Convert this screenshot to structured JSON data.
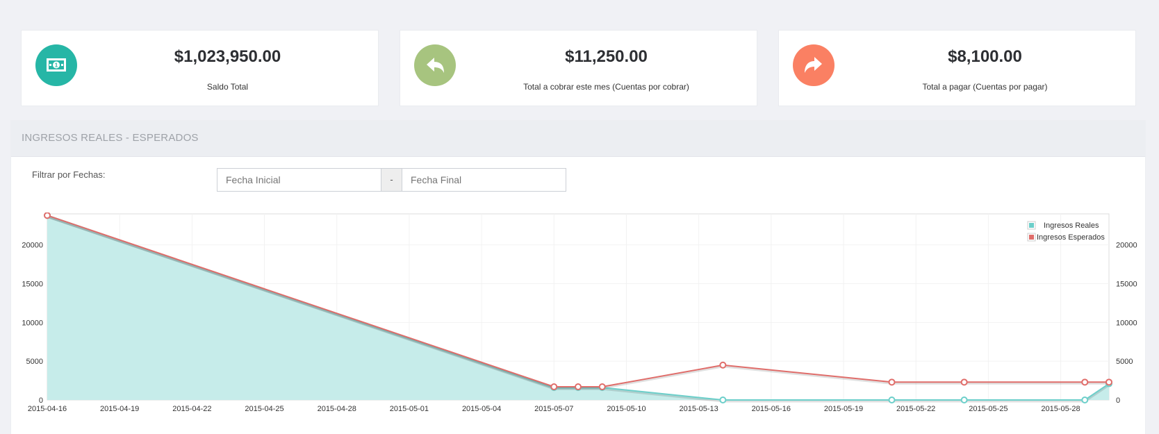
{
  "stats": [
    {
      "amount": "$1,023,950.00",
      "caption": "Saldo Total",
      "color": "#26b6a6",
      "icon": "money-bill-icon"
    },
    {
      "amount": "$11,250.00",
      "caption": "Total a cobrar este mes (Cuentas por cobrar)",
      "color": "#a7c47f",
      "icon": "reply-arrow-icon"
    },
    {
      "amount": "$8,100.00",
      "caption": "Total a pagar (Cuentas por pagar)",
      "color": "#fa8063",
      "icon": "share-arrow-icon"
    }
  ],
  "panel": {
    "title": "INGRESOS REALES - ESPERADOS",
    "filter_label": "Filtrar por Fechas:",
    "start_placeholder": "Fecha Inicial",
    "separator": "-",
    "end_placeholder": "Fecha Final"
  },
  "chart_data": {
    "type": "area",
    "x_ticks": [
      "2015-04-16",
      "2015-04-19",
      "2015-04-22",
      "2015-04-25",
      "2015-04-28",
      "2015-05-01",
      "2015-05-04",
      "2015-05-07",
      "2015-05-10",
      "2015-05-13",
      "2015-05-16",
      "2015-05-19",
      "2015-05-22",
      "2015-05-25",
      "2015-05-28"
    ],
    "y_ticks": [
      0,
      5000,
      10000,
      15000,
      20000
    ],
    "xlim": [
      "2015-04-16",
      "2015-05-30"
    ],
    "ylim": [
      0,
      24000
    ],
    "grid": true,
    "legend_position": "top-right",
    "series": [
      {
        "name": "Ingresos Reales",
        "color": "#6ccfca",
        "fill": "#c6ecea",
        "points": [
          {
            "x": "2015-04-16",
            "y": 23800
          },
          {
            "x": "2015-05-07",
            "y": 1600
          },
          {
            "x": "2015-05-08",
            "y": 1600
          },
          {
            "x": "2015-05-09",
            "y": 1600
          },
          {
            "x": "2015-05-14",
            "y": 0
          },
          {
            "x": "2015-05-21",
            "y": 0
          },
          {
            "x": "2015-05-24",
            "y": 0
          },
          {
            "x": "2015-05-29",
            "y": 0
          },
          {
            "x": "2015-05-30",
            "y": 2100
          }
        ]
      },
      {
        "name": "Ingresos Esperados",
        "color": "#e06d6a",
        "fill": "none",
        "points": [
          {
            "x": "2015-04-16",
            "y": 23800
          },
          {
            "x": "2015-05-07",
            "y": 1700
          },
          {
            "x": "2015-05-08",
            "y": 1700
          },
          {
            "x": "2015-05-09",
            "y": 1700
          },
          {
            "x": "2015-05-14",
            "y": 4500
          },
          {
            "x": "2015-05-21",
            "y": 2300
          },
          {
            "x": "2015-05-24",
            "y": 2300
          },
          {
            "x": "2015-05-29",
            "y": 2300
          },
          {
            "x": "2015-05-30",
            "y": 2300
          }
        ]
      }
    ]
  }
}
